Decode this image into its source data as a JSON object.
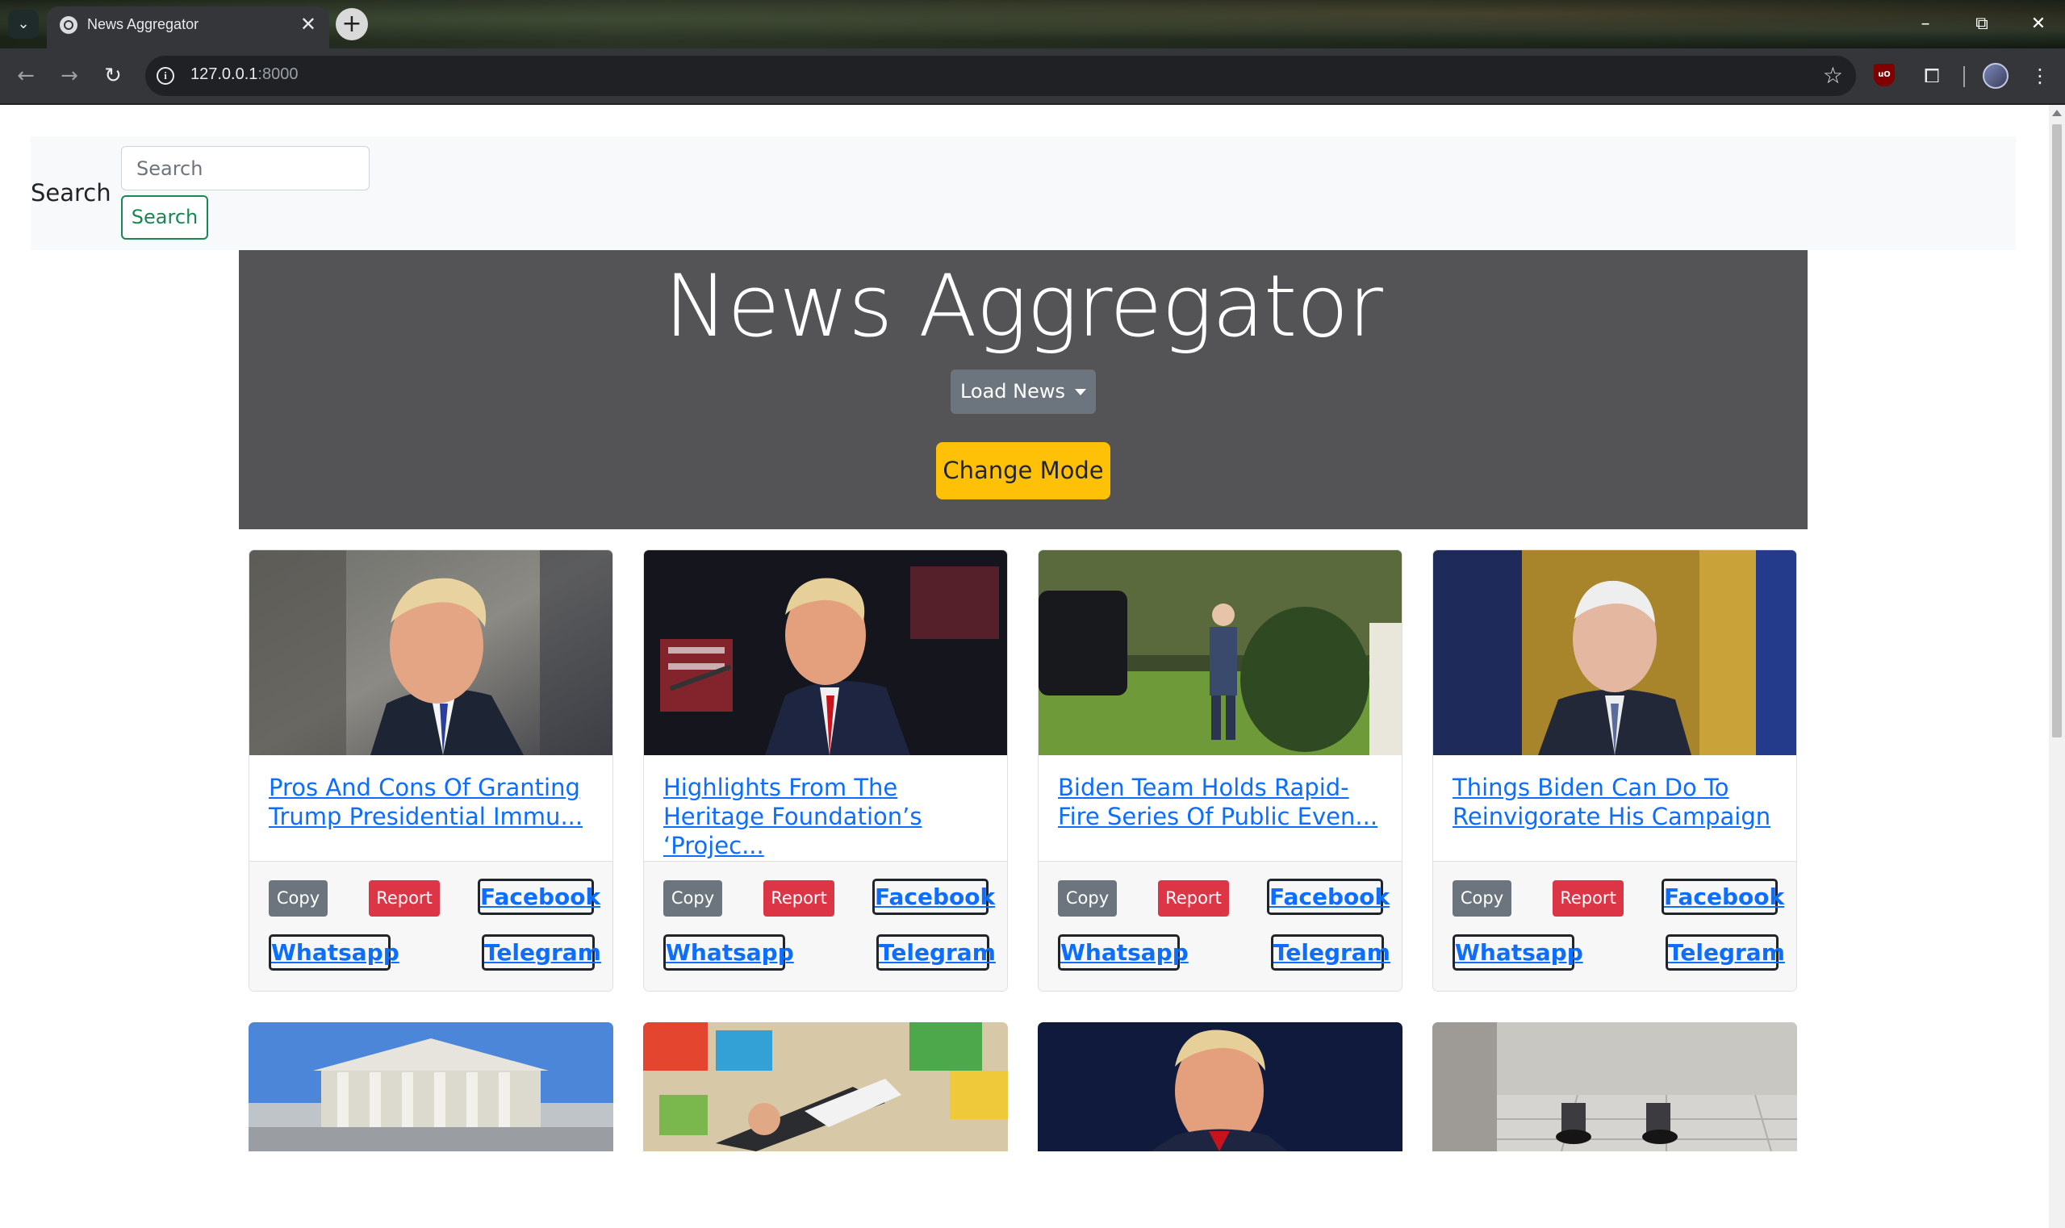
{
  "browser": {
    "tab_title": "News Aggregator",
    "url_host": "127.0.0.1",
    "url_port": ":8000",
    "new_tab_glyph": "+",
    "close_glyph": "✕",
    "icons": [
      "tab-list-icon",
      "globe-icon",
      "close-icon",
      "new-tab-icon",
      "minimize-icon",
      "restore-icon",
      "window-close-icon",
      "back-icon",
      "forward-icon",
      "reload-icon",
      "info-icon",
      "bookmark-star-icon",
      "ublock-icon",
      "extensions-icon",
      "profile-avatar",
      "more-menu-icon"
    ]
  },
  "search": {
    "label": "Search",
    "placeholder": "Search",
    "button_label": "Search"
  },
  "hero": {
    "title": "News Aggregator",
    "load_button_label": "Load News",
    "mode_button_label": "Change Mode"
  },
  "card_buttons": {
    "copy": "Copy",
    "report": "Report",
    "facebook": "Facebook",
    "whatsapp": "Whatsapp",
    "telegram": "Telegram"
  },
  "articles": [
    {
      "title": "Pros And Cons Of Granting Trump Presidential Immu..."
    },
    {
      "title": "Highlights From The Heritage Foundation’s ‘Projec..."
    },
    {
      "title": "Biden Team Holds Rapid-Fire Series Of Public Even..."
    },
    {
      "title": "Things Biden Can Do To Reinvigorate His Campaign"
    }
  ],
  "colors": {
    "hero_bg": "#545355",
    "mode_button": "#ffc107",
    "copy_button": "#6c757d",
    "report_button": "#dc3545",
    "link": "#0d6efd",
    "search_button": "#198754"
  }
}
